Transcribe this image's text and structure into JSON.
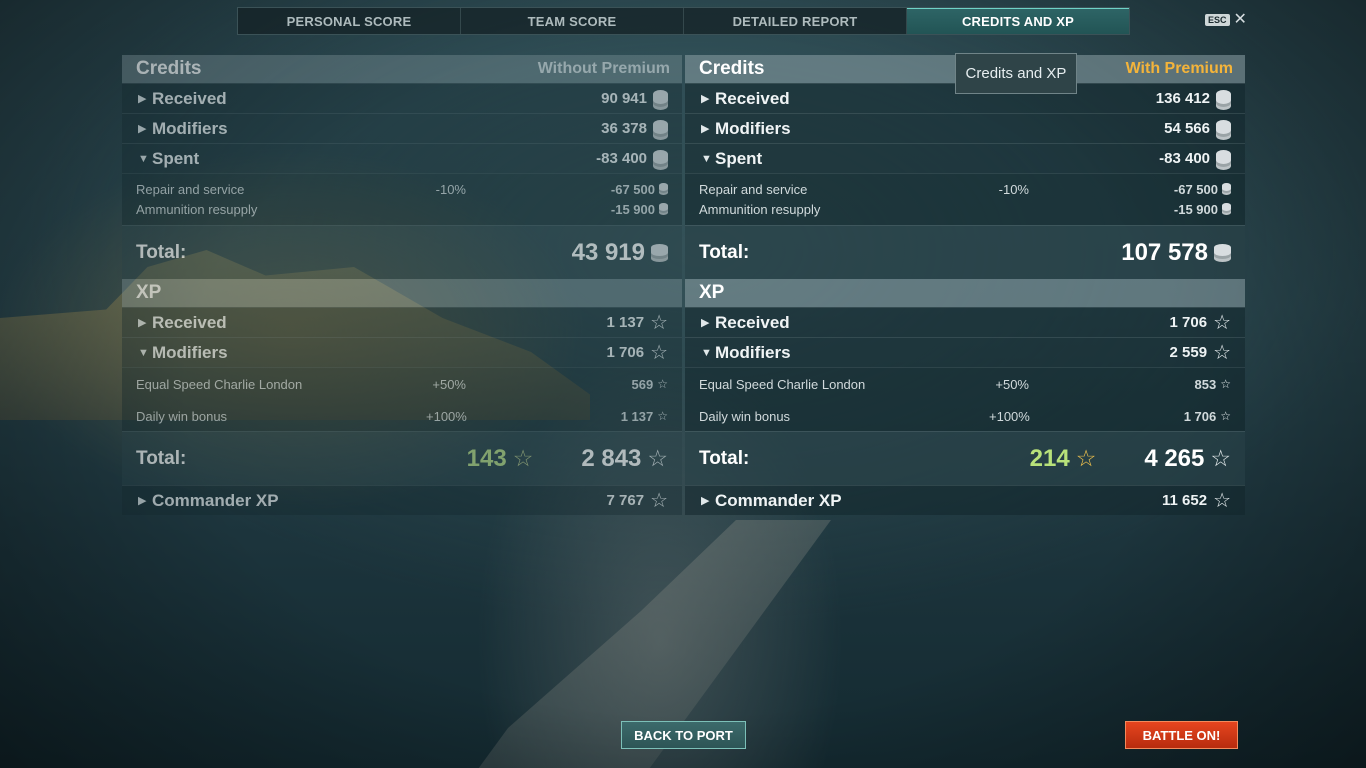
{
  "tabs": [
    {
      "label": "PERSONAL SCORE"
    },
    {
      "label": "TEAM SCORE"
    },
    {
      "label": "DETAILED REPORT"
    },
    {
      "label": "CREDITS AND XP"
    }
  ],
  "esc_label": "ESC",
  "tooltip": "Credits and XP",
  "left": {
    "credits_title": "Credits",
    "header": "Without Premium",
    "received": {
      "label": "Received",
      "value": "90 941"
    },
    "modifiers": {
      "label": "Modifiers",
      "value": "36 378"
    },
    "spent": {
      "label": "Spent",
      "value": "-83 400"
    },
    "spent_items": [
      {
        "label": "Repair and service",
        "percent": "-10%",
        "value": "-67 500"
      },
      {
        "label": "Ammunition resupply",
        "percent": "",
        "value": "-15 900"
      }
    ],
    "credits_total": {
      "label": "Total:",
      "value": "43 919"
    },
    "xp_title": "XP",
    "xp_received": {
      "label": "Received",
      "value": "1 137"
    },
    "xp_modifiers": {
      "label": "Modifiers",
      "value": "1 706"
    },
    "xp_items": [
      {
        "label": "Equal Speed Charlie London",
        "percent": "+50%",
        "value": "569"
      },
      {
        "label": "Daily win bonus",
        "percent": "+100%",
        "value": "1 137"
      }
    ],
    "xp_total": {
      "label": "Total:",
      "free_value": "143",
      "value": "2 843"
    },
    "commander": {
      "label": "Commander XP",
      "value": "7 767"
    }
  },
  "right": {
    "credits_title": "Credits",
    "header": "With Premium",
    "received": {
      "label": "Received",
      "value": "136 412"
    },
    "modifiers": {
      "label": "Modifiers",
      "value": "54 566"
    },
    "spent": {
      "label": "Spent",
      "value": "-83 400"
    },
    "spent_items": [
      {
        "label": "Repair and service",
        "percent": "-10%",
        "value": "-67 500"
      },
      {
        "label": "Ammunition resupply",
        "percent": "",
        "value": "-15 900"
      }
    ],
    "credits_total": {
      "label": "Total:",
      "value": "107 578"
    },
    "xp_title": "XP",
    "xp_received": {
      "label": "Received",
      "value": "1 706"
    },
    "xp_modifiers": {
      "label": "Modifiers",
      "value": "2 559"
    },
    "xp_items": [
      {
        "label": "Equal Speed Charlie London",
        "percent": "+50%",
        "value": "853"
      },
      {
        "label": "Daily win bonus",
        "percent": "+100%",
        "value": "1 706"
      }
    ],
    "xp_total": {
      "label": "Total:",
      "free_value": "214",
      "value": "4 265"
    },
    "commander": {
      "label": "Commander XP",
      "value": "11 652"
    }
  },
  "buttons": {
    "back_to_port": "BACK TO PORT",
    "battle_on": "BATTLE ON!"
  },
  "colors": {
    "accent_teal": "#2e6566",
    "premium_gold": "#f4b43a",
    "free_xp_green": "#b8e27a",
    "battle_red": "#d43b17"
  }
}
